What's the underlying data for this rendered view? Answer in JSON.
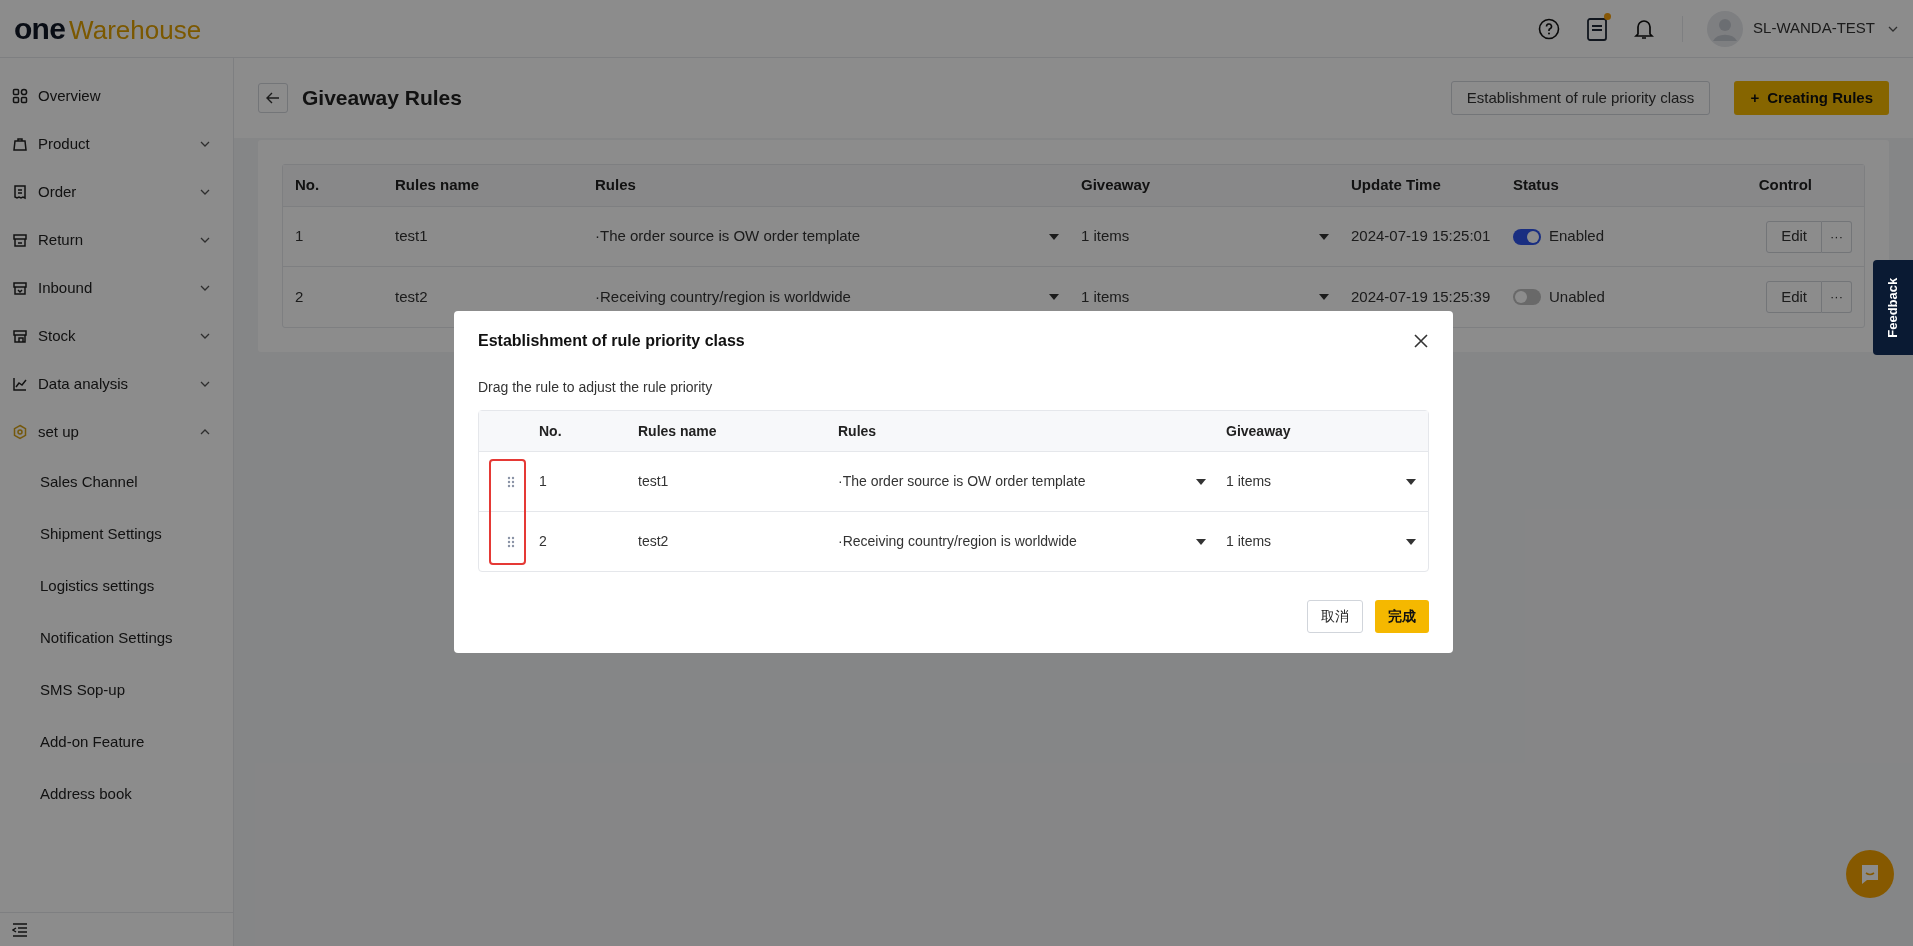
{
  "header": {
    "logo_part1": "one",
    "logo_part2": "Warehouse",
    "user": "SL-WANDA-TEST",
    "notification_dot": true
  },
  "sidebar": {
    "items": [
      {
        "label": "Overview",
        "kind": "link",
        "active": false
      },
      {
        "label": "Product",
        "kind": "group",
        "expanded": false,
        "active": false
      },
      {
        "label": "Order",
        "kind": "group",
        "expanded": false,
        "active": false
      },
      {
        "label": "Return",
        "kind": "group",
        "expanded": false,
        "active": false
      },
      {
        "label": "Inbound",
        "kind": "group",
        "expanded": false,
        "active": false
      },
      {
        "label": "Stock",
        "kind": "group",
        "expanded": false,
        "active": false
      },
      {
        "label": "Data analysis",
        "kind": "group",
        "expanded": false,
        "active": false
      },
      {
        "label": "set up",
        "kind": "group",
        "expanded": true,
        "active": true,
        "children": [
          {
            "label": "Sales Channel"
          },
          {
            "label": "Shipment Settings"
          },
          {
            "label": "Logistics settings"
          },
          {
            "label": "Notification Settings"
          },
          {
            "label": "SMS Sop-up"
          },
          {
            "label": "Add-on Feature"
          },
          {
            "label": "Address book"
          }
        ]
      }
    ]
  },
  "page": {
    "title": "Giveaway Rules",
    "buttons": [
      {
        "label": "Establishment of rule priority class",
        "kind": "secondary"
      },
      {
        "label": "Creating Rules",
        "kind": "primary",
        "plus": "+"
      }
    ]
  },
  "table": {
    "columns": [
      "No.",
      "Rules name",
      "Rules",
      "Giveaway",
      "Update Time",
      "Status",
      "Control"
    ],
    "rows": [
      {
        "no": "1",
        "name": "test1",
        "rule": "·The order source is OW order template",
        "giveaway": "1 items",
        "time": "2024-07-19 15:25:01",
        "status": "Enabled",
        "on": true,
        "edit": "Edit",
        "more": "···"
      },
      {
        "no": "2",
        "name": "test2",
        "rule": "·Receiving country/region is worldwide",
        "giveaway": "1 items",
        "time": "2024-07-19 15:25:39",
        "status": "Unabled",
        "on": false,
        "edit": "Edit",
        "more": "···"
      }
    ]
  },
  "modal": {
    "title": "Establishment of rule priority class",
    "description": "Drag the rule to adjust the rule priority",
    "columns": [
      "No.",
      "Rules name",
      "Rules",
      "Giveaway"
    ],
    "rows": [
      {
        "no": "1",
        "name": "test1",
        "rule": "·The order source is OW order template",
        "giveaway": "1 items"
      },
      {
        "no": "2",
        "name": "test2",
        "rule": "·Receiving country/region is worldwide",
        "giveaway": "1 items"
      }
    ],
    "cancel": "取消",
    "ok": "完成"
  },
  "feedback": "Feedback"
}
